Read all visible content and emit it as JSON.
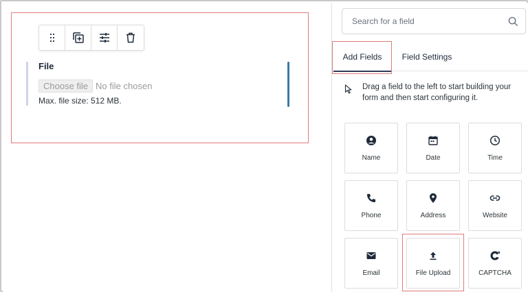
{
  "toolbar": {
    "icons": [
      "drag-handle-icon",
      "duplicate-icon",
      "settings-sliders-icon",
      "trash-icon"
    ]
  },
  "field": {
    "label": "File",
    "choose_button": "Choose file",
    "no_file_text": "No file chosen",
    "max_size_text": "Max. file size: 512 MB."
  },
  "sidebar": {
    "search_placeholder": "Search for a field",
    "tabs": [
      {
        "label": "Add Fields",
        "active": true
      },
      {
        "label": "Field Settings",
        "active": false
      }
    ],
    "hint": "Drag a field to the left to start building your form and then start configuring it.",
    "fields": [
      {
        "label": "Name",
        "icon": "person-circle-icon"
      },
      {
        "label": "Date",
        "icon": "calendar-icon"
      },
      {
        "label": "Time",
        "icon": "clock-icon"
      },
      {
        "label": "Phone",
        "icon": "phone-icon"
      },
      {
        "label": "Address",
        "icon": "location-pin-icon"
      },
      {
        "label": "Website",
        "icon": "link-icon"
      },
      {
        "label": "Email",
        "icon": "envelope-icon"
      },
      {
        "label": "File Upload",
        "icon": "upload-icon"
      },
      {
        "label": "CAPTCHA",
        "icon": "captcha-icon"
      }
    ]
  },
  "colors": {
    "highlight": "#e07b7b",
    "accent_bar": "#3b7aa6",
    "icon": "#1e2a3a"
  }
}
